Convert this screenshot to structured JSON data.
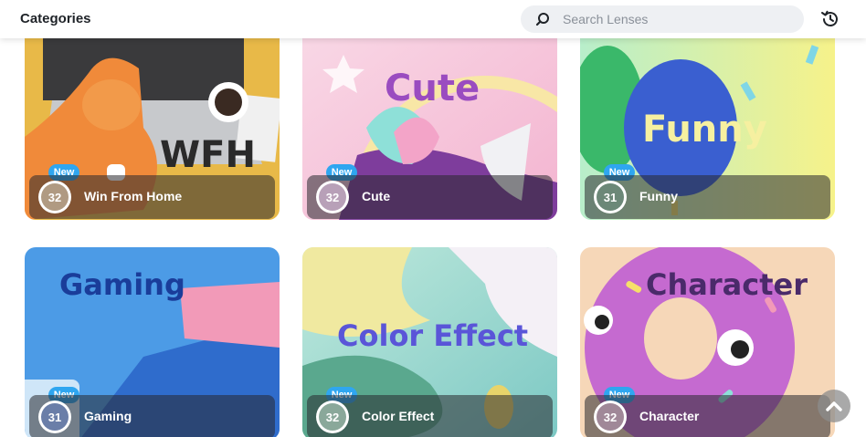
{
  "header": {
    "title": "Categories",
    "search_placeholder": "Search Lenses",
    "history_icon": "history-icon",
    "search_icon": "search-icon"
  },
  "cards": [
    {
      "label": "Win From Home",
      "art_text": "WFH",
      "count": "32",
      "badge": "New",
      "count_color": "#b09a82"
    },
    {
      "label": "Cute",
      "art_text": "Cute",
      "count": "32",
      "badge": "New",
      "count_color": "#b8a0b8"
    },
    {
      "label": "Funny",
      "art_text": "Funny",
      "count": "31",
      "badge": "New",
      "count_color": "#6c8878"
    },
    {
      "label": "Gaming",
      "art_text": "Gaming",
      "count": "31",
      "badge": "New",
      "count_color": "#6a7ea8"
    },
    {
      "label": "Color Effect",
      "art_text": "Color Effect",
      "count": "32",
      "badge": "New",
      "count_color": "#8aa89a"
    },
    {
      "label": "Character",
      "art_text": "Character",
      "count": "32",
      "badge": "New",
      "count_color": "#a08898"
    }
  ],
  "scroll_top_icon": "chevron-up-icon"
}
